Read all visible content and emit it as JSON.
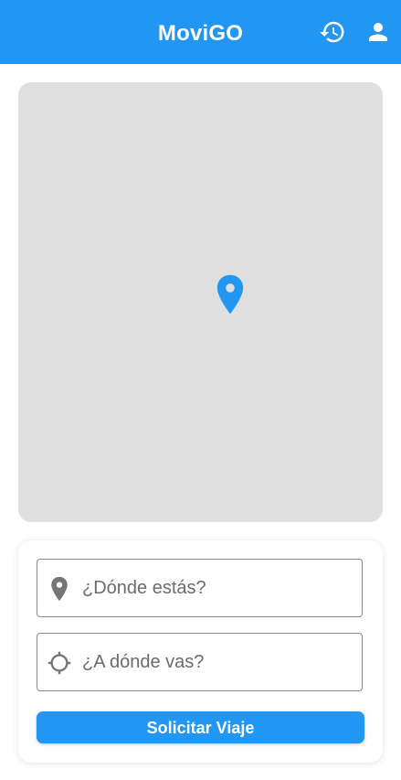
{
  "app_bar": {
    "title": "MoviGO",
    "background_color": "#2196F3",
    "actions": [
      {
        "icon": "history-icon"
      },
      {
        "icon": "person-icon"
      }
    ]
  },
  "map": {
    "background_color": "#e0e0e0",
    "marker_icon": "location-pin-icon",
    "marker_color": "#2196F3"
  },
  "trip_form": {
    "origin": {
      "icon": "location-pin-icon",
      "placeholder": "¿Dónde estás?",
      "value": ""
    },
    "destination": {
      "icon": "gps-crosshair-icon",
      "placeholder": "¿A dónde vas?",
      "value": ""
    },
    "submit_label": "Solicitar Viaje",
    "accent_color": "#2196F3"
  }
}
